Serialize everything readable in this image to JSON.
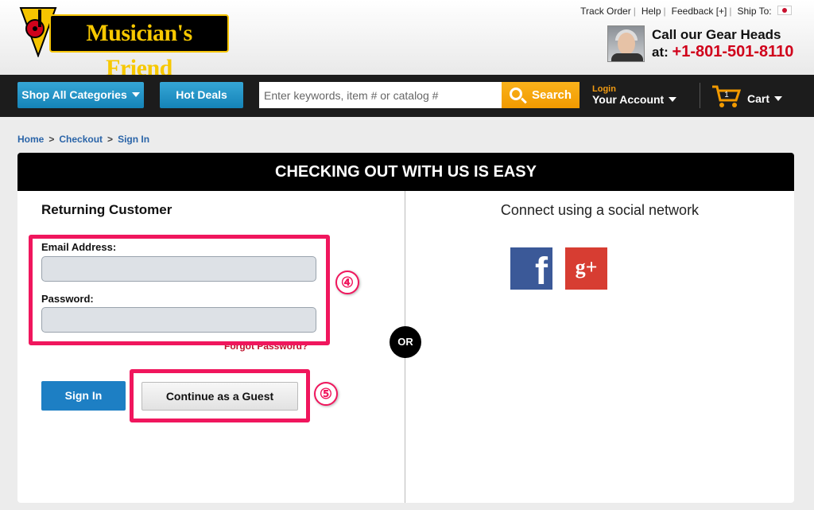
{
  "header": {
    "logo_text": "Musician's Friend",
    "util_links": [
      "Track Order",
      "Help",
      "Feedback [+]",
      "Ship To:"
    ],
    "call_line1": "Call our Gear Heads",
    "call_prefix": "at:",
    "phone": "+1-801-501-8110"
  },
  "nav": {
    "shop_all": "Shop All Categories",
    "hot_deals": "Hot Deals",
    "search_placeholder": "Enter keywords, item # or catalog #",
    "search_button": "Search",
    "login": "Login",
    "account": "Your Account",
    "cart_count": "1",
    "cart": "Cart"
  },
  "breadcrumb": [
    "Home",
    "Checkout",
    "Sign In"
  ],
  "card": {
    "heading": "CHECKING OUT WITH US IS EASY",
    "returning": "Returning Customer",
    "email_label": "Email Address:",
    "password_label": "Password:",
    "forgot": "Forgot Password?",
    "signin": "Sign In",
    "guest": "Continue as a Guest",
    "or": "OR",
    "social_title": "Connect using a social network",
    "facebook_glyph": "f",
    "gplus_glyph": "g+"
  },
  "annotations": {
    "badge_fields": "④",
    "badge_guest": "⑤"
  },
  "colors": {
    "accent_pink": "#f0165d",
    "phone_red": "#d0021b",
    "button_blue": "#1d7fc4",
    "search_orange": "#f29a00"
  }
}
